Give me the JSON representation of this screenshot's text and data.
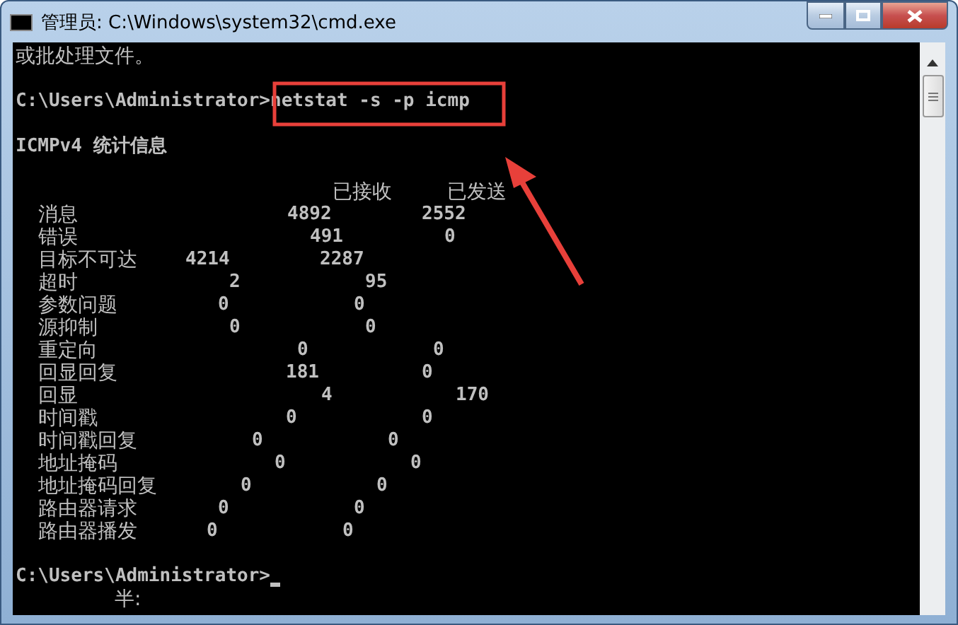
{
  "window": {
    "title": "管理员: C:\\Windows\\system32\\cmd.exe"
  },
  "console": {
    "intro": "或批处理文件。",
    "prompt_1": "C:\\Users\\Administrator>",
    "command": "netstat -s -p icmp",
    "heading": "ICMPv4 统计信息",
    "columns": [
      "已接收",
      "已发送"
    ],
    "rows": [
      {
        "label": "消息",
        "received": "4892",
        "sent": "2552"
      },
      {
        "label": "错误",
        "received": "491",
        "sent": "0"
      },
      {
        "label": "目标不可达",
        "received": "4214",
        "sent": "2287"
      },
      {
        "label": "超时",
        "received": "2",
        "sent": "95"
      },
      {
        "label": "参数问题",
        "received": "0",
        "sent": "0"
      },
      {
        "label": "源抑制",
        "received": "0",
        "sent": "0"
      },
      {
        "label": "重定向",
        "received": "0",
        "sent": "0"
      },
      {
        "label": "回显回复",
        "received": "181",
        "sent": "0"
      },
      {
        "label": "回显",
        "received": "4",
        "sent": "170"
      },
      {
        "label": "时间戳",
        "received": "0",
        "sent": "0"
      },
      {
        "label": "时间戳回复",
        "received": "0",
        "sent": "0"
      },
      {
        "label": "地址掩码",
        "received": "0",
        "sent": "0"
      },
      {
        "label": "地址掩码回复",
        "received": "0",
        "sent": "0"
      },
      {
        "label": "路由器请求",
        "received": "0",
        "sent": "0"
      },
      {
        "label": "路由器播发",
        "received": "0",
        "sent": "0"
      }
    ],
    "prompt_2": "C:\\Users\\Administrator>",
    "ime_status": "半:"
  }
}
